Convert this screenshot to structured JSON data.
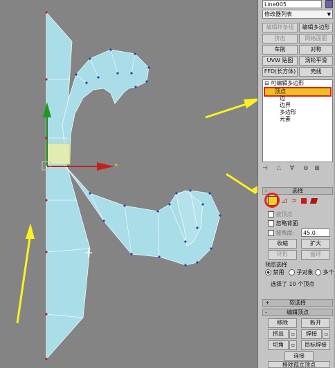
{
  "viewport": {
    "name": "3D viewport"
  },
  "panel": {
    "object_name": "Line005",
    "modifier_list_label": "修改器列表",
    "buttons": {
      "edit_spline": "编辑样条线",
      "edit_poly": "编辑多边形",
      "extrude": "挤出",
      "extrude_face": "网格面面",
      "lathe": "车削",
      "symmetry": "对称",
      "uvw_map": "UVW 贴图",
      "turbosmooth": "涡轮平滑",
      "ffd": "FFD(长方体)",
      "shell": "壳线"
    },
    "stack": {
      "modifier": "可编辑多边形",
      "items": [
        "顶点",
        "边",
        "边界",
        "多边形",
        "元素"
      ]
    },
    "selection": {
      "title": "选择",
      "by_vertex": "按顶点",
      "ignore_backfacing": "忽略背面",
      "by_angle": "按角度:",
      "angle_value": "45.0",
      "shrink": "收缩",
      "grow": "扩大",
      "ring": "环形",
      "loop": "循环",
      "preview_title": "预览选择",
      "preview_options": [
        "禁用",
        "子对象",
        "多个"
      ],
      "status": "选择了 10 个顶点"
    },
    "soft_selection": "软选择",
    "edit_vertices": {
      "title": "编辑顶点",
      "remove": "移除",
      "break": "断开",
      "extrude": "挤出",
      "weld": "焊接",
      "chamfer": "切角",
      "target_weld": "目标焊接",
      "connect": "连接",
      "remove_isolated": "移除孤立顶点"
    }
  }
}
